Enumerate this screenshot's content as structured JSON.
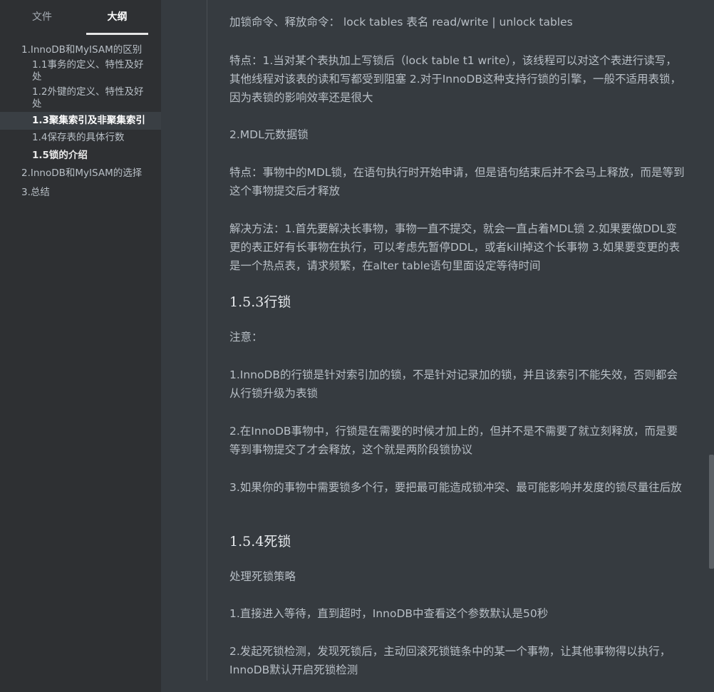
{
  "sidebar": {
    "tabs": {
      "files": "文件",
      "outline": "大纲"
    },
    "outline": [
      {
        "label": "1.InnoDB和MyISAM的区别",
        "level": 1
      },
      {
        "label": "1.1事务的定义、特性及好处",
        "level": 2
      },
      {
        "label": "1.2外键的定义、特性及好处",
        "level": 2
      },
      {
        "label": "1.3聚集索引及非聚集索引",
        "level": 2,
        "active": true
      },
      {
        "label": "1.4保存表的具体行数",
        "level": 2
      },
      {
        "label": "1.5锁的介绍",
        "level": 2,
        "bold": true
      },
      {
        "label": "2.InnoDB和MyISAM的选择",
        "level": 1
      },
      {
        "label": "3.总结",
        "level": 1
      }
    ]
  },
  "content": {
    "p1": "加锁命令、释放命令： lock tables 表名 read/write  |  unlock tables",
    "p2": "特点：1.当对某个表执加上写锁后（lock table t1 write），该线程可以对这个表进行读写，其他线程对该表的读和写都受到阻塞  2.对于InnoDB这种支持行锁的引擎，一般不适用表锁，因为表锁的影响效率还是很大",
    "p3": "2.MDL元数据锁",
    "p4": "特点：事物中的MDL锁，在语句执行时开始申请，但是语句结束后并不会马上释放，而是等到这个事物提交后才释放",
    "p5": "解决方法：1.首先要解决长事物，事物一直不提交，就会一直占着MDL锁 2.如果要做DDL变更的表正好有长事物在执行，可以考虑先暂停DDL，或者kill掉这个长事物 3.如果要变更的表是一个热点表，请求频繁，在alter table语句里面设定等待时间",
    "h153": "1.5.3行锁",
    "p6": "注意：",
    "p7": "1.InnoDB的行锁是针对索引加的锁，不是针对记录加的锁，并且该索引不能失效，否则都会从行锁升级为表锁",
    "p8": "2.在InnoDB事物中，行锁是在需要的时候才加上的，但并不是不需要了就立刻释放，而是要等到事物提交了才会释放，这个就是两阶段锁协议",
    "p9": "3.如果你的事物中需要锁多个行，要把最可能造成锁冲突、最可能影响并发度的锁尽量往后放",
    "h154": "1.5.4死锁",
    "p10": "处理死锁策略",
    "p11": "1.直接进入等待，直到超时，InnoDB中查看这个参数默认是50秒",
    "p12": "2.发起死锁检测，发现死锁后，主动回滚死锁链条中的某一个事物，让其他事物得以执行，InnoDB默认开启死锁检测"
  }
}
